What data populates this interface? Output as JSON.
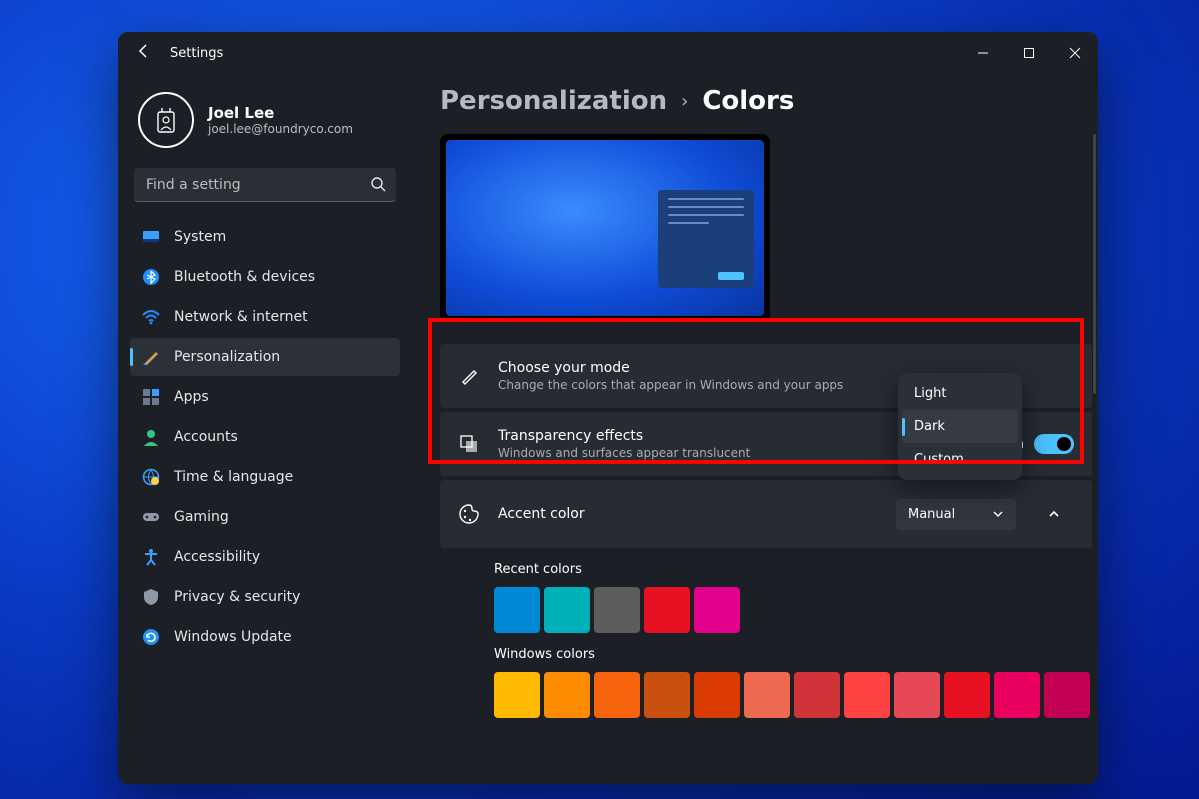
{
  "titlebar": {
    "title": "Settings"
  },
  "profile": {
    "name": "Joel Lee",
    "email": "joel.lee@foundryco.com"
  },
  "search": {
    "placeholder": "Find a setting"
  },
  "sidebar": {
    "items": [
      {
        "label": "System"
      },
      {
        "label": "Bluetooth & devices"
      },
      {
        "label": "Network & internet"
      },
      {
        "label": "Personalization"
      },
      {
        "label": "Apps"
      },
      {
        "label": "Accounts"
      },
      {
        "label": "Time & language"
      },
      {
        "label": "Gaming"
      },
      {
        "label": "Accessibility"
      },
      {
        "label": "Privacy & security"
      },
      {
        "label": "Windows Update"
      }
    ]
  },
  "breadcrumb": {
    "parent": "Personalization",
    "current": "Colors"
  },
  "cards": {
    "mode": {
      "title": "Choose your mode",
      "subtitle": "Change the colors that appear in Windows and your apps"
    },
    "transparency": {
      "title": "Transparency effects",
      "subtitle": "Windows and surfaces appear translucent",
      "toggle_state": "On"
    },
    "accent": {
      "title": "Accent color",
      "dropdown_value": "Manual"
    }
  },
  "mode_menu": {
    "options": [
      {
        "label": "Light"
      },
      {
        "label": "Dark"
      },
      {
        "label": "Custom"
      }
    ],
    "selected": "Dark"
  },
  "recent_colors": {
    "label": "Recent colors",
    "colors": [
      "#0089d6",
      "#00b0b9",
      "#5d5d5d",
      "#e81123",
      "#e3008c"
    ]
  },
  "windows_colors": {
    "label": "Windows colors",
    "colors": [
      "#ffb900",
      "#ff8c00",
      "#f7630c",
      "#ca5010",
      "#da3b01",
      "#ef6950",
      "#d13438",
      "#ff4343",
      "#e74856",
      "#e81123",
      "#ea005e",
      "#c30052"
    ]
  }
}
